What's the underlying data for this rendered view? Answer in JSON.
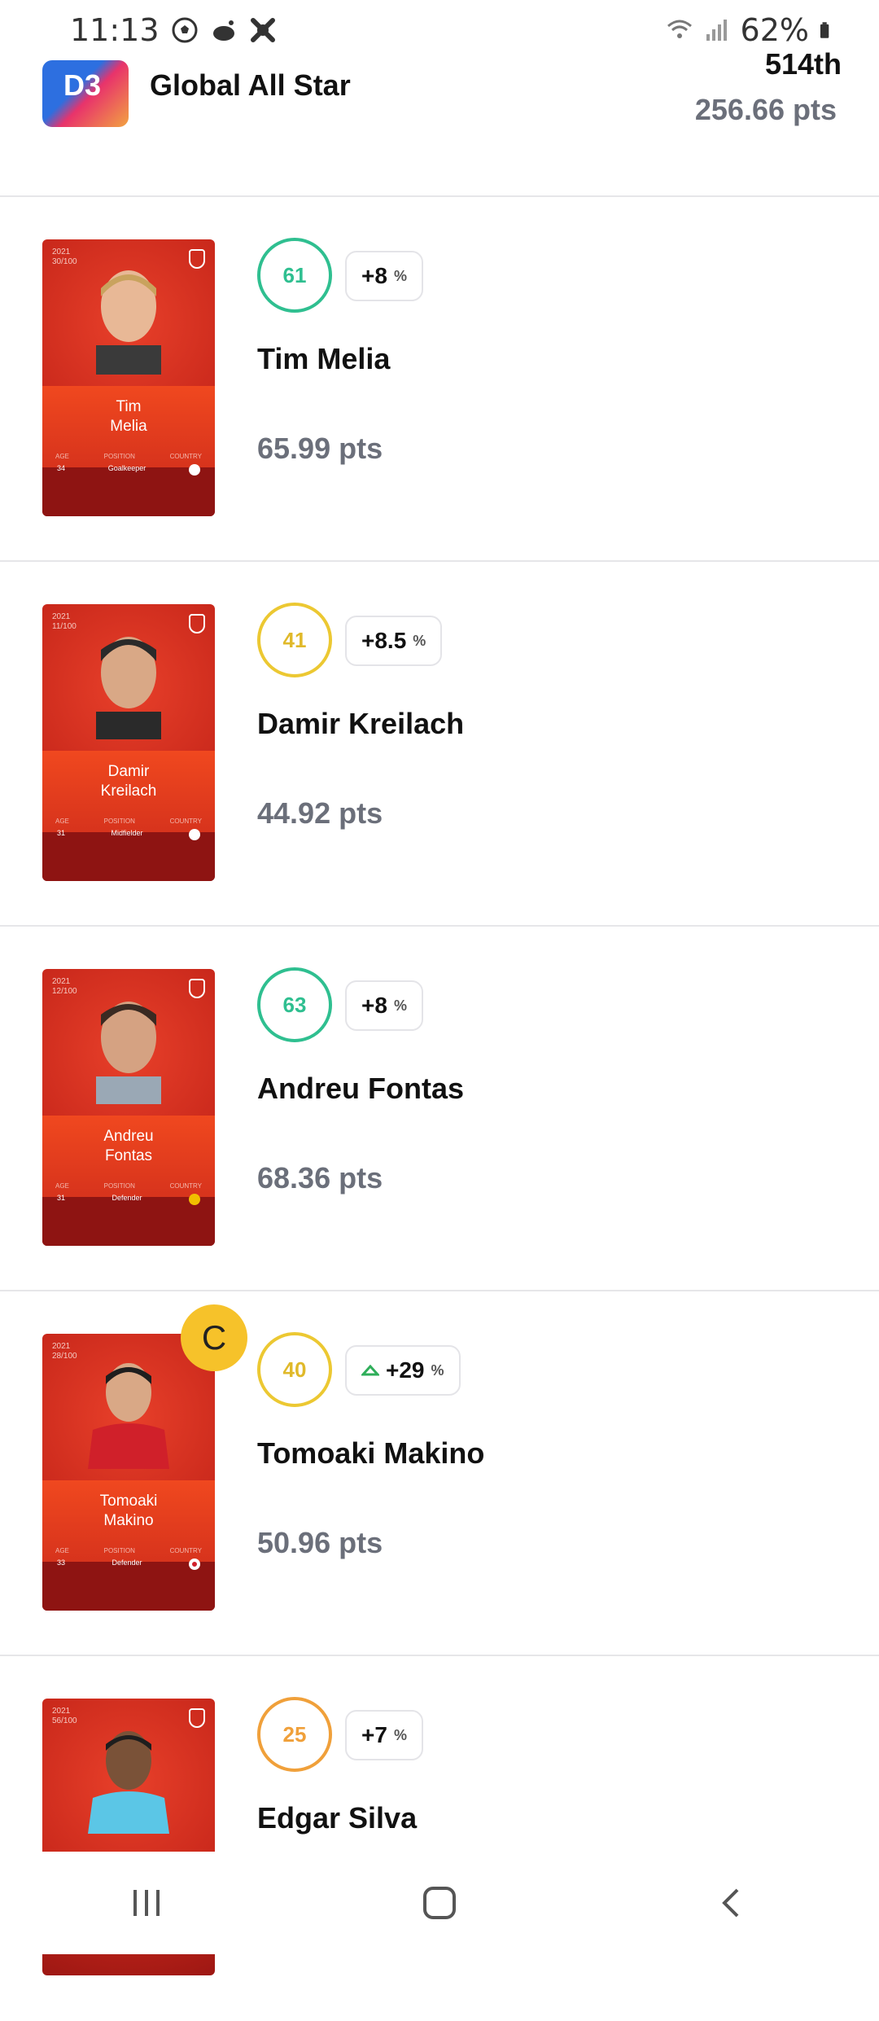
{
  "status_bar": {
    "time": "11:13",
    "battery": "62%"
  },
  "header": {
    "logo_text": "D3",
    "league_name": "Global All Star",
    "rank": "514th",
    "total_points": "256.66 pts"
  },
  "players": [
    {
      "name": "Tim Melia",
      "card_name_line1": "Tim",
      "card_name_line2": "Melia",
      "score": "61",
      "bonus": "+8",
      "bonus_trend": "none",
      "points": "65.99 pts",
      "card_year": "2021",
      "card_serial": "30/100",
      "age": "34",
      "position": "Goalkeeper",
      "ring_color": "green",
      "captain": false
    },
    {
      "name": "Damir Kreilach",
      "card_name_line1": "Damir",
      "card_name_line2": "Kreilach",
      "score": "41",
      "bonus": "+8.5",
      "bonus_trend": "none",
      "points": "44.92 pts",
      "card_year": "2021",
      "card_serial": "11/100",
      "age": "31",
      "position": "Midfielder",
      "ring_color": "yellow",
      "captain": false
    },
    {
      "name": "Andreu Fontas",
      "card_name_line1": "Andreu",
      "card_name_line2": "Fontas",
      "score": "63",
      "bonus": "+8",
      "bonus_trend": "none",
      "points": "68.36 pts",
      "card_year": "2021",
      "card_serial": "12/100",
      "age": "31",
      "position": "Defender",
      "ring_color": "green",
      "captain": false
    },
    {
      "name": "Tomoaki Makino",
      "card_name_line1": "Tomoaki",
      "card_name_line2": "Makino",
      "score": "40",
      "bonus": "+29",
      "bonus_trend": "up",
      "points": "50.96 pts",
      "card_year": "2021",
      "card_serial": "28/100",
      "age": "33",
      "position": "Defender",
      "ring_color": "yellow",
      "captain": true,
      "captain_label": "C"
    },
    {
      "name": "Edgar Silva",
      "card_name_line1": "",
      "card_name_line2": "",
      "score": "25",
      "bonus": "+7",
      "bonus_trend": "none",
      "points": "",
      "card_year": "2021",
      "card_serial": "56/100",
      "age": "",
      "position": "",
      "ring_color": "orange",
      "captain": false
    }
  ],
  "card_meta_labels": {
    "age": "AGE",
    "position": "POSITION",
    "country": "COUNTRY"
  },
  "percent_sign": "%",
  "colors": {
    "ring_green": "#2fbf90",
    "ring_yellow": "#ecc832",
    "ring_orange": "#f0a03a",
    "captain": "#f6c22a",
    "points_gray": "#6b6f7a"
  },
  "nav": {
    "recents_icon": "recents-icon",
    "home_icon": "home-icon",
    "back_icon": "back-icon"
  }
}
